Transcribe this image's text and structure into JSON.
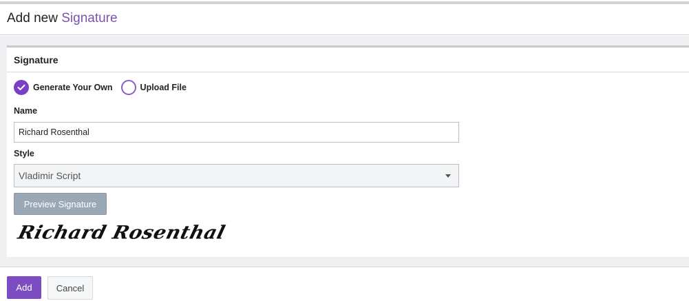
{
  "header": {
    "title_prefix": "Add new",
    "title_accent": "Signature"
  },
  "panel": {
    "title": "Signature",
    "radio_options": [
      {
        "label": "Generate Your Own",
        "checked": true
      },
      {
        "label": "Upload File",
        "checked": false
      }
    ],
    "name_label": "Name",
    "name_value": "Richard Rosenthal",
    "style_label": "Style",
    "style_value": "Vladimir Script",
    "preview_button_label": "Preview Signature",
    "signature_preview_text": "Richard Rosenthal"
  },
  "footer": {
    "add_label": "Add",
    "cancel_label": "Cancel"
  },
  "colors": {
    "accent": "#7a52b3",
    "primary_button": "#7b4cc2",
    "preview_button": "#9aa7b5"
  },
  "icons": {
    "radio_checked": "check-icon",
    "select_caret": "caret-down-icon"
  }
}
